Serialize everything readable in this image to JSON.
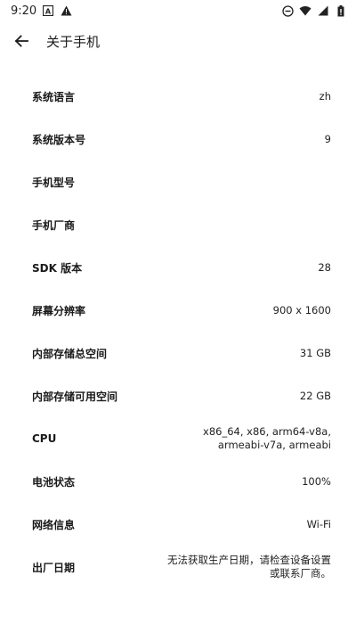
{
  "status_bar": {
    "time": "9:20",
    "icons_left": [
      "a-letter-icon",
      "warning-icon"
    ],
    "icons_right": [
      "do-not-disturb-icon",
      "wifi-icon",
      "signal-icon",
      "battery-icon"
    ]
  },
  "app_bar": {
    "title": "关于手机",
    "back_icon": "arrow-left-icon"
  },
  "info": [
    {
      "label": "系统语言",
      "value": "zh"
    },
    {
      "label": "系统版本号",
      "value": "9"
    },
    {
      "label": "手机型号",
      "value": ""
    },
    {
      "label": "手机厂商",
      "value": ""
    },
    {
      "label": "SDK 版本",
      "value": "28"
    },
    {
      "label": "屏幕分辨率",
      "value": "900 x 1600"
    },
    {
      "label": "内部存储总空间",
      "value": "31 GB"
    },
    {
      "label": "内部存储可用空间",
      "value": "22 GB"
    },
    {
      "label": "CPU",
      "value": "x86_64, x86, arm64-v8a,\narmeabi-v7a, armeabi"
    },
    {
      "label": "电池状态",
      "value": "100%"
    },
    {
      "label": "网络信息",
      "value": "Wi-Fi"
    },
    {
      "label": "出厂日期",
      "value": "无法获取生产日期，请检查设备设置\n或联系厂商。"
    }
  ]
}
